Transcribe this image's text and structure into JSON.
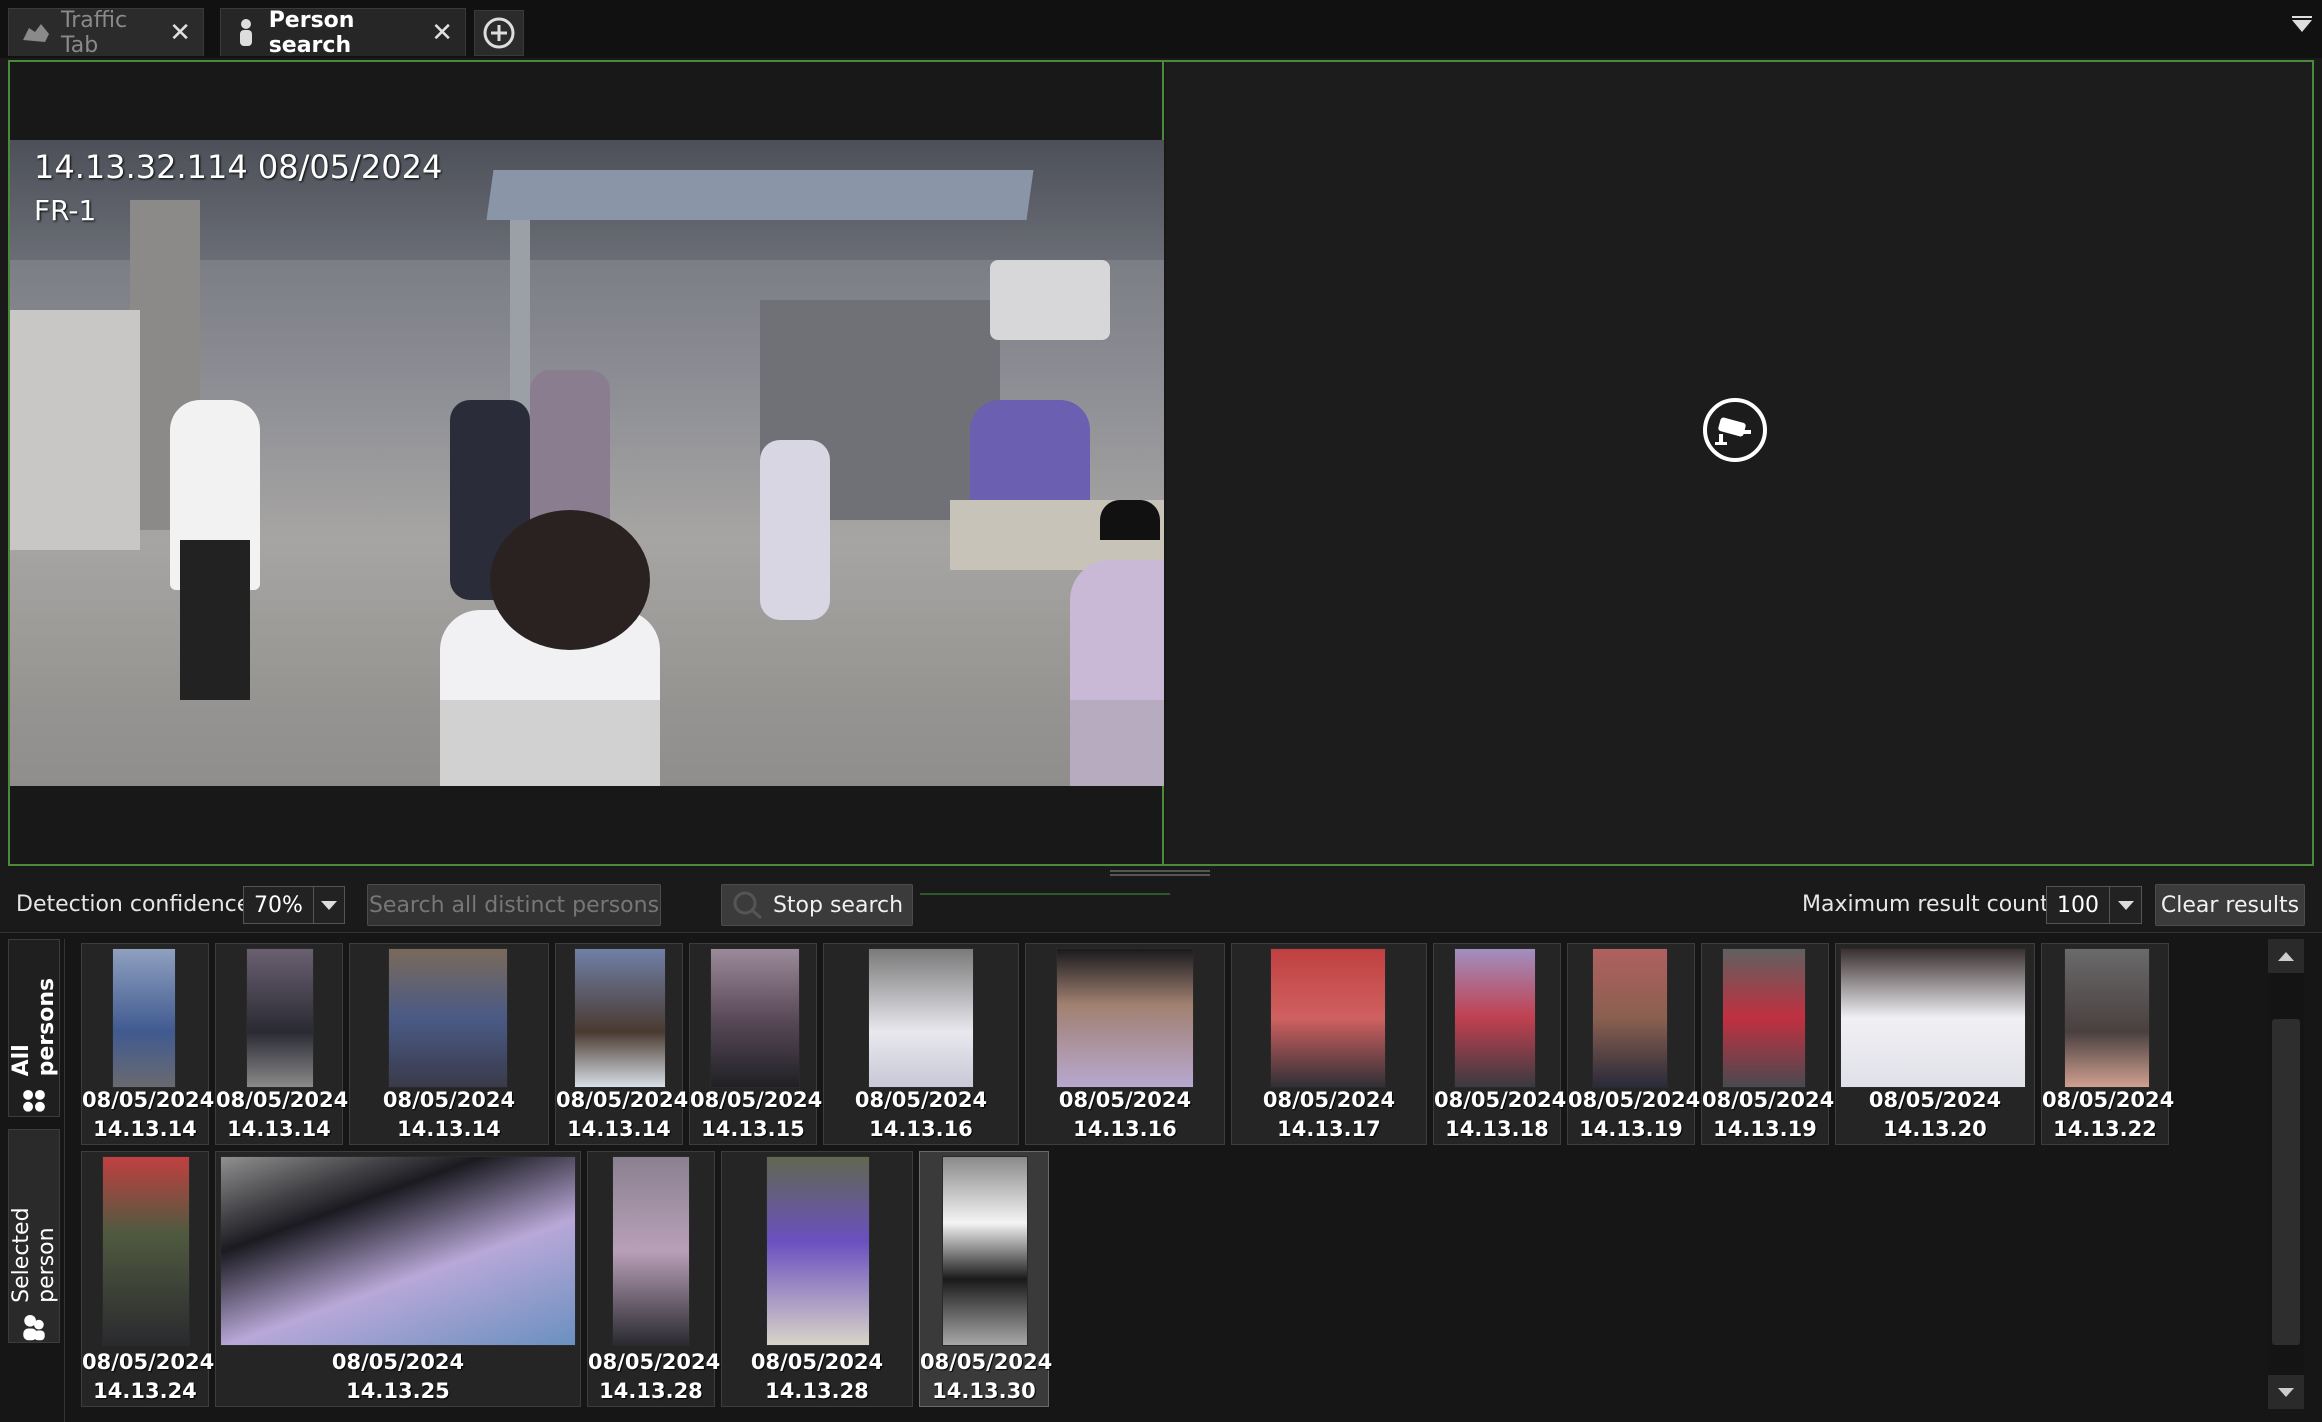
{
  "tabs": [
    {
      "label": "Traffic Tab",
      "icon": "traffic-icon",
      "active": false
    },
    {
      "label": "Person search",
      "icon": "person-icon",
      "active": true
    }
  ],
  "video": {
    "left_overlay_time": "14.13.32.114  08/05/2024",
    "left_overlay_cam": "FR-1",
    "right_pane_icon": "camera-icon"
  },
  "toolbar": {
    "confidence_label": "Detection confidence",
    "confidence_value": "70%",
    "search_distinct_label": "Search all distinct persons",
    "stop_search_label": "Stop search",
    "max_result_label": "Maximum result count",
    "max_result_value": "100",
    "clear_results_label": "Clear results"
  },
  "side_tabs": {
    "all_persons": "All persons",
    "selected_person": "Selected person"
  },
  "results_row1": [
    {
      "date": "08/05/2024",
      "time": "14.13.14"
    },
    {
      "date": "08/05/2024",
      "time": "14.13.14"
    },
    {
      "date": "08/05/2024",
      "time": "14.13.14"
    },
    {
      "date": "08/05/2024",
      "time": "14.13.14"
    },
    {
      "date": "08/05/2024",
      "time": "14.13.15"
    },
    {
      "date": "08/05/2024",
      "time": "14.13.16"
    },
    {
      "date": "08/05/2024",
      "time": "14.13.16"
    },
    {
      "date": "08/05/2024",
      "time": "14.13.17"
    },
    {
      "date": "08/05/2024",
      "time": "14.13.18"
    },
    {
      "date": "08/05/2024",
      "time": "14.13.19"
    },
    {
      "date": "08/05/2024",
      "time": "14.13.19"
    },
    {
      "date": "08/05/2024",
      "time": "14.13.20"
    },
    {
      "date": "08/05/2024",
      "time": "14.13.22"
    }
  ],
  "results_row2": [
    {
      "date": "08/05/2024",
      "time": "14.13.24"
    },
    {
      "date": "08/05/2024",
      "time": "14.13.25"
    },
    {
      "date": "08/05/2024",
      "time": "14.13.28"
    },
    {
      "date": "08/05/2024",
      "time": "14.13.28"
    },
    {
      "date": "08/05/2024",
      "time": "14.13.30"
    }
  ],
  "colors": {
    "accent_border": "#4b8a3a",
    "background": "#1a1a1a"
  }
}
